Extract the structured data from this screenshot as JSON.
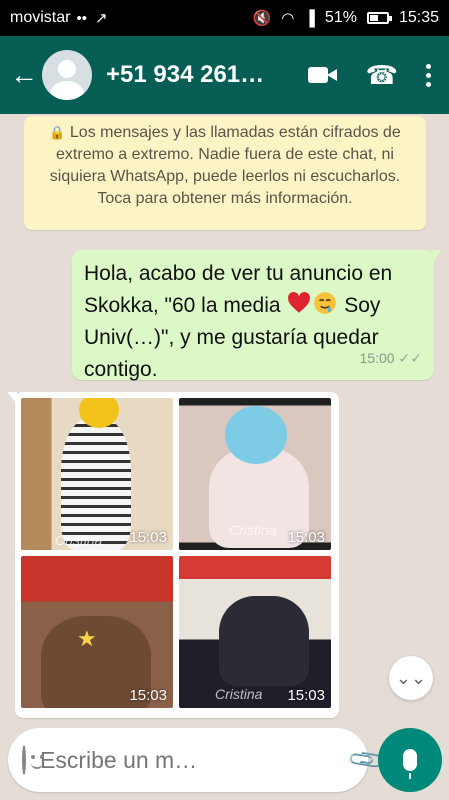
{
  "status_bar": {
    "carrier": "movistar",
    "battery": "51%",
    "battery_level": 0.51,
    "time": "15:35"
  },
  "header": {
    "contact": "+51 934 261…"
  },
  "notice": {
    "text": "Los mensajes y las llamadas están cifrados de extremo a extremo. Nadie fuera de este chat, ni siquiera WhatsApp, puede leerlos ni escucharlos. Toca para obtener más información."
  },
  "outgoing": {
    "part1": "Hola, acabo de ver tu anuncio en Skokka, \"60 la media ",
    "part2": " Soy Univ(…)\", y me gustaría quedar contigo.",
    "time": "15:00",
    "emojis": [
      "red-heart",
      "drooling-face"
    ]
  },
  "media": {
    "photos": [
      {
        "time": "15:03",
        "watermark": "Cristina"
      },
      {
        "time": "15:03",
        "watermark": "Cristina"
      },
      {
        "time": "15:03",
        "watermark": ""
      },
      {
        "time": "15:03",
        "watermark": "Cristina"
      }
    ]
  },
  "composer": {
    "placeholder": "Escribe un m…"
  },
  "colors": {
    "header": "#075e54",
    "outgoing_bubble": "#dcf8c6",
    "notice_bg": "#fdf4c5",
    "fab": "#00897b"
  }
}
